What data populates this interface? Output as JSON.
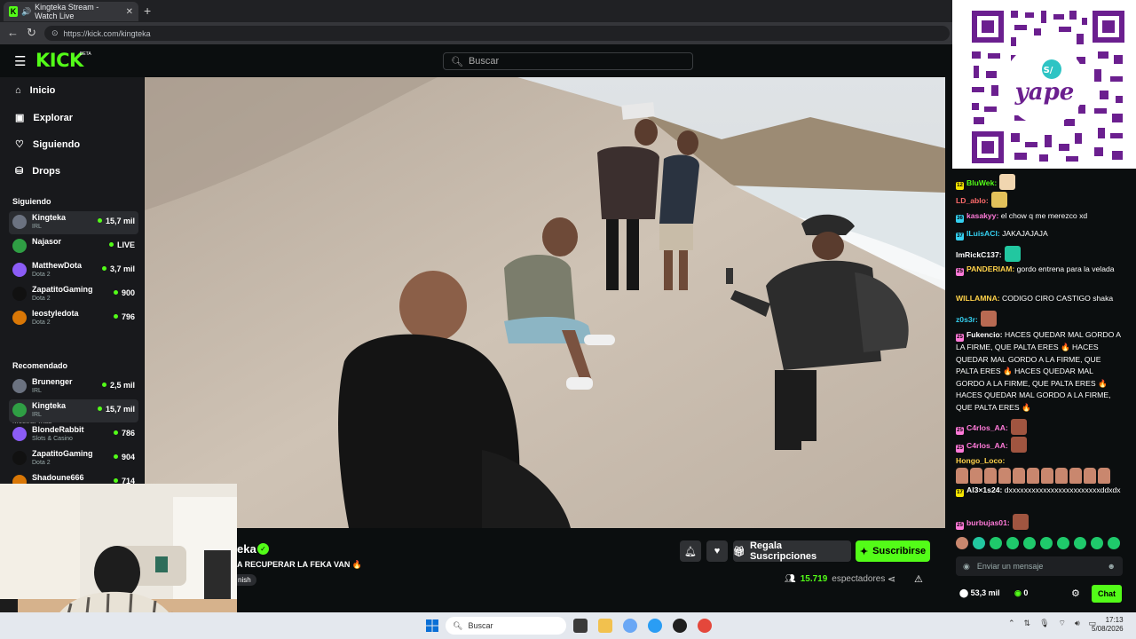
{
  "browser": {
    "tab_title": "Kingteka Stream - Watch Live",
    "url": "https://kick.com/kingteka"
  },
  "header": {
    "logo": "KICK",
    "logo_badge": "BETA",
    "search_placeholder": "Buscar"
  },
  "sidebar": {
    "nav": [
      {
        "label": "Inicio",
        "icon": "home-icon"
      },
      {
        "label": "Explorar",
        "icon": "explore-icon"
      },
      {
        "label": "Siguiendo",
        "icon": "heart-icon"
      },
      {
        "label": "Drops",
        "icon": "drops-icon"
      }
    ],
    "following_title": "Siguiendo",
    "following": [
      {
        "name": "Kingteka",
        "category": "IRL",
        "viewers": "15,7 mil",
        "selected": true
      },
      {
        "name": "Najasor",
        "category": "",
        "viewers": "LIVE"
      },
      {
        "name": "MatthewDota",
        "category": "Dota 2",
        "viewers": "3,7 mil"
      },
      {
        "name": "ZapatitoGaming",
        "category": "Dota 2",
        "viewers": "900"
      },
      {
        "name": "leostyledota",
        "category": "Dota 2",
        "viewers": "796"
      }
    ],
    "show_more": "Mostrar más",
    "recommended_title": "Recomendado",
    "recommended": [
      {
        "name": "Brunenger",
        "category": "IRL",
        "viewers": "2,5 mil"
      },
      {
        "name": "Kingteka",
        "category": "IRL",
        "viewers": "15,7 mil",
        "selected": true
      },
      {
        "name": "BlondeRabbit",
        "category": "Slots & Casino",
        "viewers": "786"
      },
      {
        "name": "ZapatitoGaming",
        "category": "Dota 2",
        "viewers": "904"
      },
      {
        "name": "Shadoune666",
        "category": "",
        "viewers": "714"
      }
    ]
  },
  "stream": {
    "channel_name": "eka",
    "title": "A RECUPERAR LA FEKA VAN 🔥",
    "language": "nish",
    "gift_label": "Regala Suscripciones",
    "subscribe_label": "Suscribirse",
    "viewers_count": "15.719",
    "viewers_label": "espectadores"
  },
  "qr": {
    "brand": "yape"
  },
  "chat": {
    "messages": [
      {
        "badge": "12",
        "badge_color": "#f5e400",
        "user": "BluWek:",
        "user_color": "#53fc18",
        "text": "",
        "emote": "#f1d6b0"
      },
      {
        "badge": "",
        "user": "LD_ablo:",
        "user_color": "#ff6b6b",
        "text": "",
        "emote": "#e3c15a"
      },
      {
        "badge": "36",
        "badge_color": "#35d0f0",
        "user": "kasakyy:",
        "user_color": "#ff7ad9",
        "text": "el chow q me merezco xd"
      },
      {
        "badge": "37",
        "badge_color": "#35d0f0",
        "user": "ILuisACI:",
        "user_color": "#35d0f0",
        "text": "JAKAJAJAJA"
      },
      {
        "badge": "",
        "user": "ImRickC137:",
        "user_color": "#fff",
        "text": "",
        "emote": "#22c7a0"
      },
      {
        "badge": "25",
        "badge_color": "#ff7ad9",
        "user": "PANDERIAM:",
        "user_color": "#ffd24a",
        "text": "gordo entrena para la velada"
      },
      {
        "badge": "",
        "user": "WILLAMNA:",
        "user_color": "#ffd24a",
        "text": "CODIGO CIRO CASTIGO shaka"
      },
      {
        "badge": "",
        "user": "z0s3r:",
        "user_color": "#35d0f0",
        "text": "",
        "emote": "#b86a52"
      },
      {
        "badge": "25",
        "badge_color": "#ff7ad9",
        "user": "Fukencio:",
        "user_color": "#fff",
        "text": "HACES QUEDAR MAL GORDO A LA FIRME, QUE PALTA ERES 🔥 HACES QUEDAR MAL GORDO A LA FIRME, QUE PALTA ERES 🔥 HACES QUEDAR MAL GORDO A LA FIRME, QUE PALTA ERES 🔥 HACES QUEDAR MAL GORDO A LA FIRME, QUE PALTA ERES 🔥"
      },
      {
        "badge": "25",
        "badge_color": "#ff7ad9",
        "user": "C4rlos_AA:",
        "user_color": "#ff7ad9",
        "text": "",
        "emote": "#a05540"
      },
      {
        "badge": "25",
        "badge_color": "#ff7ad9",
        "user": "C4rlos_AA:",
        "user_color": "#ff7ad9",
        "text": "",
        "emote": "#a05540"
      },
      {
        "badge": "",
        "user": "Hongo_Loco:",
        "user_color": "#ffd24a",
        "text": ""
      },
      {
        "badge": "17",
        "badge_color": "#f5e400",
        "user": "Al3×1s24:",
        "user_color": "#fff",
        "text": "dxxxxxxxxxxxxxxxxxxxxxxxxddxdx"
      },
      {
        "badge": "25",
        "badge_color": "#ff7ad9",
        "user": "burbujas01:",
        "user_color": "#ff7ad9",
        "text": "",
        "emote": "#a05540"
      }
    ],
    "input_placeholder": "Enviar un mensaje",
    "points": "53,3 mil",
    "kick_points": "0",
    "send_label": "Chat"
  },
  "taskbar": {
    "search_placeholder": "Buscar",
    "time": "17:13",
    "date": "5/08/2026"
  }
}
